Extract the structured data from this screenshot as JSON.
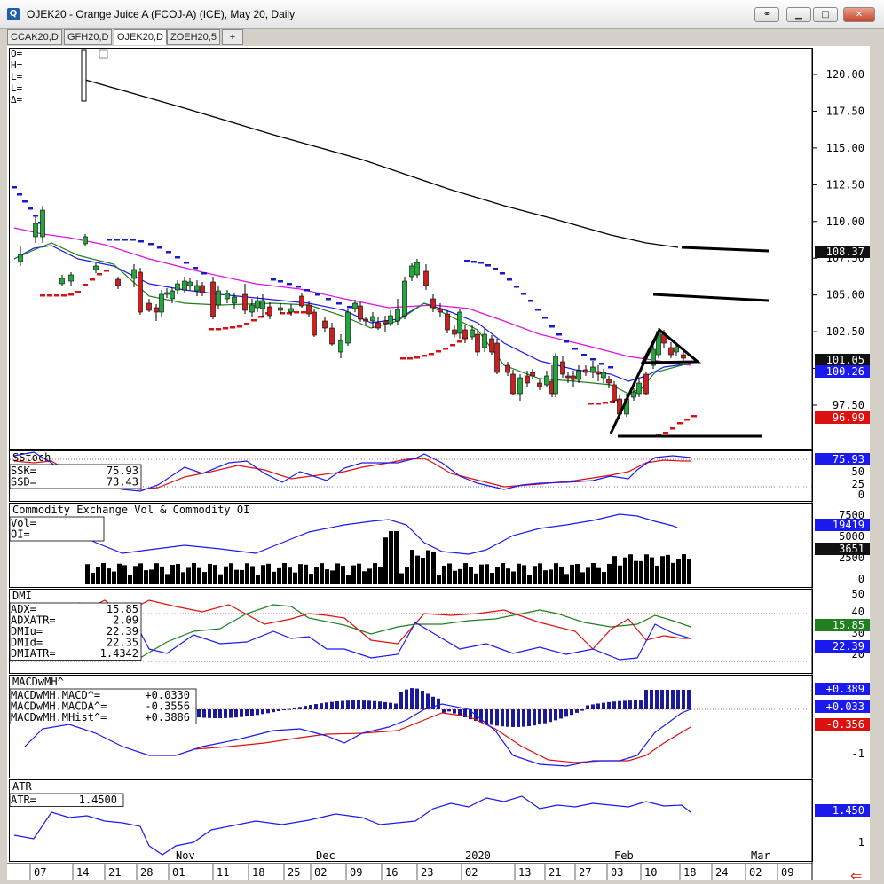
{
  "window": {
    "title": "OJEK20 - Orange Juice A (FCOJ-A) (ICE), May 20, Daily"
  },
  "tabs": [
    {
      "label": "CCAK20,D"
    },
    {
      "label": "GFH20,D"
    },
    {
      "label": "OJEK20,D",
      "active": true
    },
    {
      "label": "ZOEH20,5"
    },
    {
      "label": "+"
    }
  ],
  "colors": {
    "up": "#22a83a",
    "down": "#cc2020",
    "ma_blue": "#1a1aee",
    "ma_magenta": "#e010e0",
    "ma_green": "#208020",
    "psar": "#1a1acc",
    "psar_red": "#dd1010"
  },
  "ohlc_labels": [
    "O=",
    "H=",
    "L=",
    "L=",
    "Δ="
  ],
  "price_panel": {
    "axis_labels": [
      "120.00",
      "117.50",
      "115.00",
      "112.50",
      "110.00",
      "107.50",
      "105.00",
      "102.50",
      "100.00",
      "97.50"
    ],
    "badges": [
      {
        "text": "108.37",
        "bg": "#111111"
      },
      {
        "text": "101.05",
        "bg": "#111111"
      },
      {
        "text": "100.26",
        "bg": "#1a1aee"
      },
      {
        "text": "96.99",
        "bg": "#dd1010"
      }
    ]
  },
  "sstoch": {
    "title": "SStoch",
    "rows": [
      {
        "label": "SSK=",
        "value": "75.93"
      },
      {
        "label": "SSD=",
        "value": "73.43"
      }
    ],
    "axis": [
      "50",
      "25",
      "0"
    ],
    "badge": "75.93"
  },
  "volume": {
    "title": "Commodity Exchange Vol & Commodity OI",
    "rows": [
      {
        "label": "Vol="
      },
      {
        "label": "OI="
      }
    ],
    "axis": [
      "7500",
      "5000",
      "2500",
      "0"
    ],
    "badges": [
      {
        "text": "19419",
        "bg": "#1a1aee"
      },
      {
        "text": "3651",
        "bg": "#111111"
      }
    ]
  },
  "dmi": {
    "title": "DMI",
    "rows": [
      {
        "label": "ADX=",
        "value": "15.85"
      },
      {
        "label": "ADXATR=",
        "value": "2.09"
      },
      {
        "label": "DMIu=",
        "value": "22.39"
      },
      {
        "label": "DMId=",
        "value": "22.35"
      },
      {
        "label": "DMIATR=",
        "value": "1.4342"
      }
    ],
    "axis": [
      "50",
      "40",
      "30",
      "20"
    ],
    "badges": [
      {
        "text": "15.85",
        "bg": "#208020"
      },
      {
        "text": "22.39",
        "bg": "#1a1aee"
      }
    ]
  },
  "macd": {
    "title": "MACDwMH^",
    "rows": [
      {
        "label": "MACDwMH.MACD^=",
        "value": "+0.0330"
      },
      {
        "label": "MACDwMH.MACDA^=",
        "value": "-0.3556"
      },
      {
        "label": "MACDwMH.MHist^=",
        "value": "+0.3886"
      }
    ],
    "axis": [
      "-1"
    ],
    "badges": [
      {
        "text": "+0.389",
        "bg": "#1a1aee"
      },
      {
        "text": "+0.033",
        "bg": "#1a1aee"
      },
      {
        "text": "-0.356",
        "bg": "#dd1010"
      }
    ]
  },
  "atr": {
    "title": "ATR",
    "rows": [
      {
        "label": "ATR=",
        "value": "1.4500"
      }
    ],
    "axis": [
      "1.500",
      "1"
    ],
    "badge": "1.450"
  },
  "time_axis": {
    "months": [
      "Nov",
      "Dec",
      "2020",
      "Feb",
      "Mar"
    ],
    "days": [
      "07",
      "14",
      "21",
      "28",
      "01",
      "11",
      "18",
      "25",
      "02",
      "09",
      "16",
      "23",
      "02",
      "13",
      "21",
      "27",
      "03",
      "10",
      "18",
      "24",
      "02",
      "09"
    ]
  }
}
